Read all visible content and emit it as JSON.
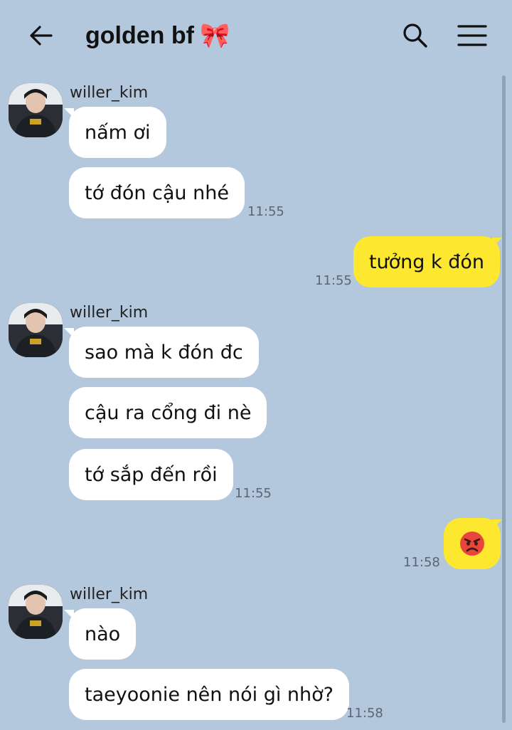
{
  "header": {
    "title": "golden bf",
    "ribbon": "🎀"
  },
  "icons": {
    "back": "arrow-left-icon",
    "search": "search-icon",
    "menu": "hamburger-menu-icon"
  },
  "colors": {
    "background": "#b3c8dc",
    "incoming_bubble": "#ffffff",
    "outgoing_bubble": "#fde82f"
  },
  "groups": [
    {
      "sender": "willer_kim",
      "messages": [
        "nấm ơi",
        "tớ đón cậu nhé"
      ],
      "time": "11:55"
    },
    {
      "sender": "me",
      "messages": [
        "tưởng k đón"
      ],
      "time": "11:55"
    },
    {
      "sender": "willer_kim",
      "messages": [
        "sao mà k đón đc",
        "cậu ra cổng đi nè",
        "tớ sắp đến rồi"
      ],
      "time": "11:55"
    },
    {
      "sender": "me",
      "messages": [
        "angry-face-emoji"
      ],
      "time": "11:58"
    },
    {
      "sender": "willer_kim",
      "messages": [
        "nào",
        "taeyoonie nên nói gì nhờ?"
      ],
      "time": "11:58"
    }
  ]
}
